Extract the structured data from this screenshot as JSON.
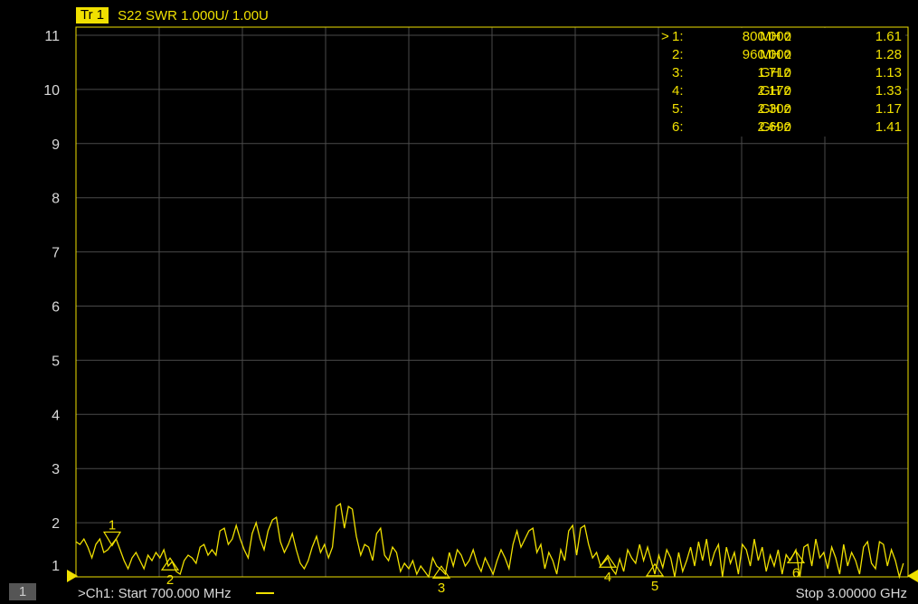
{
  "trace": {
    "badge": "Tr 1",
    "description": "S22 SWR 1.000U/  1.00U"
  },
  "y_ticks": [
    "11",
    "10",
    "9",
    "8",
    "7",
    "6",
    "5",
    "4",
    "3",
    "2",
    "1"
  ],
  "markers": [
    {
      "active": ">",
      "num": "1:",
      "freq": "800.000",
      "unit": "MH z",
      "value": "1.61",
      "label": "1"
    },
    {
      "active": "",
      "num": "2:",
      "freq": "960.000",
      "unit": "MH z",
      "value": "1.28",
      "label": "2"
    },
    {
      "active": "",
      "num": "3:",
      "freq": "1.710",
      "unit": "GH z",
      "value": "1.13",
      "label": "3"
    },
    {
      "active": "",
      "num": "4:",
      "freq": "2.170",
      "unit": "GH z",
      "value": "1.33",
      "label": "4"
    },
    {
      "active": "",
      "num": "5:",
      "freq": "2.300",
      "unit": "GH z",
      "value": "1.17",
      "label": "5"
    },
    {
      "active": "",
      "num": "6:",
      "freq": "2.690",
      "unit": "GH z",
      "value": "1.41",
      "label": "6"
    }
  ],
  "footer": {
    "channel_number": "1",
    "start": ">Ch1:  Start   700.000 MHz",
    "stop": "Stop  3.00000 GHz"
  },
  "colors": {
    "trace": "#f0e000",
    "grid": "#4a4a4a",
    "frame": "#f0e000"
  },
  "chart_data": {
    "type": "line",
    "ylim": [
      1,
      11
    ],
    "xlim_mhz": [
      700,
      3000
    ],
    "y_per_div": 1.0,
    "series": [
      {
        "name": "S22 SWR",
        "x_mhz": [
          700,
          711,
          722,
          733,
          744,
          755,
          766,
          777,
          788,
          800,
          811,
          822,
          833,
          844,
          855,
          866,
          877,
          888,
          899,
          910,
          921,
          932,
          943,
          955,
          966,
          977,
          988,
          999,
          1010,
          1021,
          1032,
          1043,
          1054,
          1065,
          1076,
          1087,
          1098,
          1110,
          1121,
          1132,
          1143,
          1154,
          1165,
          1176,
          1187,
          1198,
          1209,
          1220,
          1231,
          1243,
          1254,
          1265,
          1276,
          1287,
          1298,
          1309,
          1320,
          1331,
          1342,
          1353,
          1365,
          1376,
          1387,
          1398,
          1409,
          1420,
          1431,
          1442,
          1453,
          1464,
          1475,
          1487,
          1498,
          1509,
          1520,
          1531,
          1542,
          1553,
          1564,
          1575,
          1586,
          1597,
          1608,
          1620,
          1631,
          1642,
          1653,
          1664,
          1675,
          1686,
          1697,
          1710,
          1721,
          1732,
          1743,
          1754,
          1765,
          1776,
          1787,
          1798,
          1809,
          1820,
          1831,
          1842,
          1853,
          1864,
          1875,
          1886,
          1897,
          1908,
          1919,
          1930,
          1941,
          1952,
          1963,
          1974,
          1985,
          1996,
          2007,
          2018,
          2029,
          2040,
          2051,
          2062,
          2073,
          2084,
          2095,
          2106,
          2117,
          2128,
          2139,
          2150,
          2170,
          2181,
          2192,
          2203,
          2214,
          2225,
          2236,
          2247,
          2258,
          2269,
          2280,
          2300,
          2311,
          2322,
          2333,
          2344,
          2355,
          2366,
          2377,
          2388,
          2399,
          2410,
          2421,
          2432,
          2443,
          2454,
          2465,
          2476,
          2487,
          2498,
          2509,
          2520,
          2531,
          2542,
          2553,
          2564,
          2575,
          2586,
          2597,
          2608,
          2619,
          2630,
          2641,
          2652,
          2663,
          2674,
          2690,
          2701,
          2712,
          2723,
          2734,
          2745,
          2756,
          2767,
          2778,
          2789,
          2800,
          2811,
          2822,
          2833,
          2844,
          2855,
          2866,
          2877,
          2888,
          2899,
          2910,
          2921,
          2932,
          2943,
          2954,
          2965,
          2976,
          2987,
          3000
        ],
        "y": [
          1.65,
          1.6,
          1.7,
          1.55,
          1.35,
          1.6,
          1.7,
          1.45,
          1.5,
          1.61,
          1.7,
          1.5,
          1.3,
          1.15,
          1.35,
          1.45,
          1.3,
          1.15,
          1.4,
          1.3,
          1.45,
          1.35,
          1.5,
          1.2,
          1.28,
          1.1,
          1.05,
          1.3,
          1.4,
          1.35,
          1.25,
          1.55,
          1.6,
          1.4,
          1.5,
          1.4,
          1.85,
          1.9,
          1.6,
          1.7,
          1.95,
          1.7,
          1.5,
          1.35,
          1.8,
          2.0,
          1.7,
          1.5,
          1.85,
          2.05,
          2.1,
          1.65,
          1.45,
          1.6,
          1.8,
          1.5,
          1.25,
          1.15,
          1.3,
          1.55,
          1.75,
          1.45,
          1.6,
          1.35,
          1.55,
          2.3,
          2.35,
          1.9,
          2.3,
          2.25,
          1.75,
          1.4,
          1.6,
          1.55,
          1.3,
          1.8,
          1.9,
          1.4,
          1.3,
          1.55,
          1.45,
          1.1,
          1.25,
          1.15,
          1.3,
          1.05,
          1.2,
          1.1,
          1.0,
          1.35,
          1.2,
          1.13,
          1.05,
          1.45,
          1.2,
          1.5,
          1.4,
          1.2,
          1.3,
          1.5,
          1.25,
          1.1,
          1.35,
          1.2,
          1.05,
          1.3,
          1.5,
          1.35,
          1.15,
          1.6,
          1.85,
          1.55,
          1.7,
          1.85,
          1.9,
          1.45,
          1.6,
          1.15,
          1.45,
          1.3,
          1.05,
          1.5,
          1.3,
          1.85,
          1.95,
          1.4,
          1.9,
          1.95,
          1.6,
          1.35,
          1.45,
          1.2,
          1.35,
          1.15,
          1.05,
          1.33,
          1.1,
          1.5,
          1.35,
          1.25,
          1.6,
          1.3,
          1.55,
          1.05,
          1.4,
          1.17,
          1.5,
          1.35,
          1.0,
          1.45,
          1.1,
          1.3,
          1.55,
          1.2,
          1.65,
          1.3,
          1.7,
          1.2,
          1.45,
          1.6,
          1.0,
          1.55,
          1.25,
          1.45,
          1.05,
          1.6,
          1.5,
          1.2,
          1.7,
          1.3,
          1.55,
          1.1,
          1.4,
          1.2,
          1.5,
          1.05,
          1.41,
          1.3,
          1.5,
          1.0,
          1.55,
          1.6,
          1.2,
          1.7,
          1.35,
          1.45,
          1.15,
          1.55,
          1.35,
          1.05,
          1.6,
          1.2,
          1.45,
          1.3,
          1.05,
          1.55,
          1.65,
          1.25,
          1.15,
          1.65,
          1.6,
          1.2,
          1.5,
          1.3,
          1.0,
          1.25
        ]
      }
    ]
  }
}
